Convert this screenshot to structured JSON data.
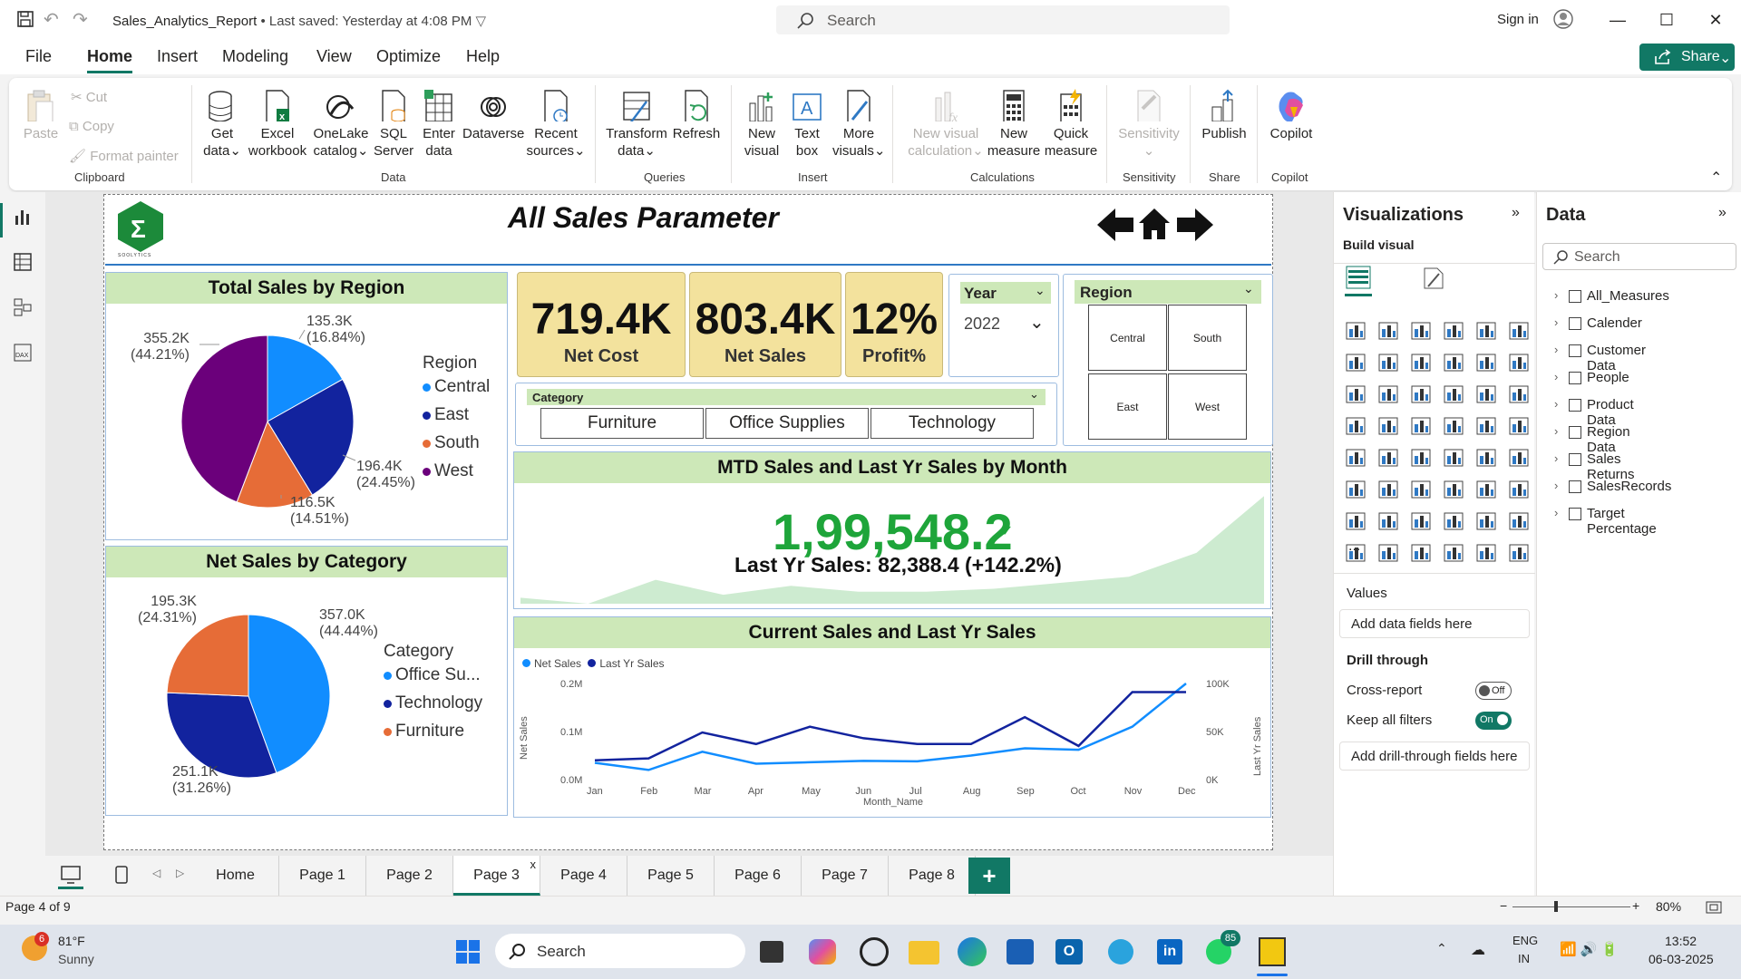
{
  "window": {
    "title": "Sales_Analytics_Report",
    "saved": "• Last saved: Yesterday at 4:08 PM",
    "search_placeholder": "Search",
    "sign_in": "Sign in"
  },
  "menu": {
    "items": [
      "File",
      "Home",
      "Insert",
      "Modeling",
      "View",
      "Optimize",
      "Help"
    ],
    "share": "Share"
  },
  "ribbon": {
    "clipboard": {
      "paste": "Paste",
      "cut": "Cut",
      "copy": "Copy",
      "format_painter": "Format painter",
      "group": "Clipboard"
    },
    "data": {
      "get_data": [
        "Get",
        "data"
      ],
      "excel": [
        "Excel",
        "workbook"
      ],
      "onelake": [
        "OneLake",
        "catalog"
      ],
      "sql": [
        "SQL",
        "Server"
      ],
      "enter": [
        "Enter",
        "data"
      ],
      "dataverse": "Dataverse",
      "recent": [
        "Recent",
        "sources"
      ],
      "group": "Data"
    },
    "queries": {
      "transform": [
        "Transform",
        "data"
      ],
      "refresh": "Refresh",
      "group": "Queries"
    },
    "insert": {
      "new_visual": [
        "New",
        "visual"
      ],
      "text_box": [
        "Text",
        "box"
      ],
      "more_visuals": [
        "More",
        "visuals"
      ],
      "group": "Insert"
    },
    "calculations": {
      "new_visual_calc": [
        "New visual",
        "calculation"
      ],
      "new_measure": [
        "New",
        "measure"
      ],
      "quick_measure": [
        "Quick",
        "measure"
      ],
      "group": "Calculations"
    },
    "sensitivity": {
      "label": "Sensitivity",
      "group": "Sensitivity"
    },
    "share": {
      "publish": "Publish",
      "group": "Share"
    },
    "copilot": {
      "label": "Copilot",
      "group": "Copilot"
    }
  },
  "report": {
    "title": "All Sales Parameter",
    "logo_text": "ΣSOOLYTICS",
    "region_chart": {
      "title": "Total Sales by Region",
      "legend_title": "Region",
      "labels": [
        {
          "v": "135.3K",
          "p": "(16.84%)"
        },
        {
          "v": "196.4K",
          "p": "(24.45%)"
        },
        {
          "v": "116.5K",
          "p": "(14.51%)"
        },
        {
          "v": "355.2K",
          "p": "(44.21%)"
        }
      ]
    },
    "category_chart": {
      "title": "Net Sales by Category",
      "legend_title": "Category",
      "labels": [
        {
          "v": "357.0K",
          "p": "(44.44%)"
        },
        {
          "v": "251.1K",
          "p": "(31.26%)"
        },
        {
          "v": "195.3K",
          "p": "(24.31%)"
        }
      ]
    },
    "kpis": [
      {
        "value": "719.4K",
        "label": "Net Cost"
      },
      {
        "value": "803.4K",
        "label": "Net Sales"
      },
      {
        "value": "12%",
        "label": "Profit%"
      }
    ],
    "year_slicer": {
      "title": "Year",
      "value": "2022"
    },
    "region_slicer": {
      "title": "Region",
      "options": [
        "Central",
        "South",
        "East",
        "West"
      ]
    },
    "category_slicer": {
      "title": "Category",
      "options": [
        "Furniture",
        "Office Supplies",
        "Technology"
      ]
    },
    "mtd": {
      "title": "MTD Sales and Last Yr Sales by Month",
      "value": "1,99,548.2",
      "sub": "Last Yr Sales: 82,388.4 (+142.2%)"
    },
    "line_chart": {
      "title": "Current Sales and Last Yr Sales",
      "legend": [
        "Net Sales",
        "Last Yr Sales"
      ],
      "y_left_label": "Net Sales",
      "y_right_label": "Last Yr Sales",
      "x_label": "Month_Name",
      "y_left_ticks": [
        "0.2M",
        "0.1M",
        "0.0M"
      ],
      "y_right_ticks": [
        "100K",
        "50K",
        "0K"
      ]
    }
  },
  "chart_data": [
    {
      "type": "pie",
      "title": "Total Sales by Region",
      "categories": [
        "Central",
        "East",
        "South",
        "West"
      ],
      "values": [
        135.3,
        196.4,
        116.5,
        355.2
      ],
      "percentages": [
        16.84,
        24.45,
        14.51,
        44.21
      ],
      "colors": [
        "#118dff",
        "#12239e",
        "#e66c37",
        "#6b007b"
      ],
      "legend_title": "Region",
      "legend_position": "right"
    },
    {
      "type": "pie",
      "title": "Net Sales by Category",
      "categories": [
        "Office Supplies",
        "Technology",
        "Furniture"
      ],
      "legend_labels": [
        "Office Su...",
        "Technology",
        "Furniture"
      ],
      "values": [
        357.0,
        251.1,
        195.3
      ],
      "percentages": [
        44.44,
        31.26,
        24.31
      ],
      "colors": [
        "#118dff",
        "#12239e",
        "#e66c37"
      ],
      "legend_title": "Category",
      "legend_position": "right"
    },
    {
      "type": "area",
      "title": "MTD Sales and Last Yr Sales by Month",
      "x": [
        "Jan",
        "Feb",
        "Mar",
        "Apr",
        "May",
        "Jun",
        "Jul",
        "Aug",
        "Sep",
        "Oct",
        "Nov",
        "Dec"
      ],
      "values": [
        4,
        0,
        16,
        6,
        12,
        8,
        8,
        10,
        14,
        18,
        34,
        72
      ]
    },
    {
      "type": "line",
      "title": "Current Sales and Last Yr Sales",
      "xlabel": "Month_Name",
      "ylabel": "Net Sales",
      "y2label": "Last Yr Sales",
      "x": [
        "Jan",
        "Feb",
        "Mar",
        "Apr",
        "May",
        "Jun",
        "Jul",
        "Aug",
        "Sep",
        "Oct",
        "Nov",
        "Dec"
      ],
      "ylim": [
        0,
        0.2
      ],
      "y2lim": [
        0,
        100
      ],
      "series": [
        {
          "name": "Net Sales",
          "axis": "left",
          "color": "#118dff",
          "values": [
            0.035,
            0.02,
            0.058,
            0.033,
            0.036,
            0.039,
            0.038,
            0.05,
            0.065,
            0.062,
            0.11,
            0.2
          ]
        },
        {
          "name": "Last Yr Sales",
          "axis": "right",
          "color": "#12239e",
          "values": [
            20,
            22,
            49,
            37,
            55,
            43,
            37,
            37,
            65,
            35,
            91,
            91
          ]
        }
      ],
      "legend_position": "top-left"
    }
  ],
  "visualizations": {
    "title": "Visualizations",
    "build": "Build visual",
    "values": "Values",
    "add_fields": "Add data fields here",
    "drill": "Drill through",
    "cross": "Cross-report",
    "cross_state": "Off",
    "keep": "Keep all filters",
    "keep_state": "On",
    "add_drill": "Add drill-through fields here",
    "more": "..."
  },
  "data_pane": {
    "title": "Data",
    "search": "Search",
    "tables": [
      "All_Measures",
      "Calender",
      "Customer Data",
      "People",
      "Product Data",
      "Region Data",
      "Sales Returns",
      "SalesRecords",
      "Target Percentage"
    ]
  },
  "pages": {
    "tabs": [
      "Home",
      "Page 1",
      "Page 2",
      "Page 3",
      "Page 4",
      "Page 5",
      "Page 6",
      "Page 7",
      "Page 8"
    ],
    "active": "Page 3",
    "close": "x",
    "add": "+"
  },
  "status": {
    "page": "Page 4 of 9",
    "zoom": "80%"
  },
  "taskbar": {
    "weather_temp": "81°F",
    "weather_cond": "Sunny",
    "weather_badge": "6",
    "search": "Search",
    "whatsapp_badge": "85",
    "lang1": "ENG",
    "lang2": "IN",
    "time": "13:52",
    "date": "06-03-2025"
  }
}
